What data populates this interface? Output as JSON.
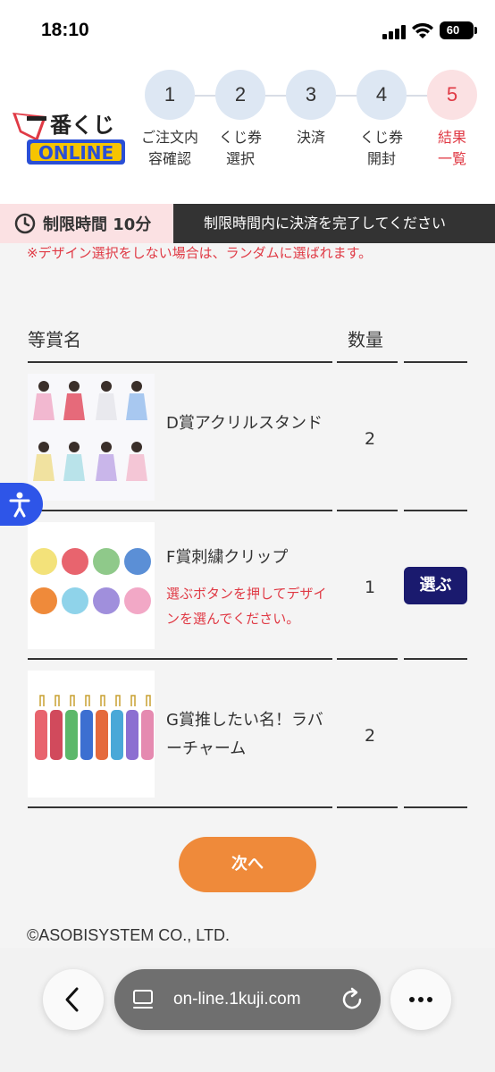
{
  "status_bar": {
    "time": "18:10",
    "battery": "60"
  },
  "header": {
    "logo_text": "一番くじ ONLINE",
    "steps": [
      {
        "number": "1",
        "label": "ご注文内容確認"
      },
      {
        "number": "2",
        "label": "くじ券選択"
      },
      {
        "number": "3",
        "label": "決済"
      },
      {
        "number": "4",
        "label": "くじ券開封"
      },
      {
        "number": "5",
        "label": "結果一覧"
      }
    ],
    "active_step": 5,
    "colors": {
      "active": "#e03a45",
      "inactive_circle": "#dde7f3"
    }
  },
  "time_limit": {
    "label": "制限時間 10分",
    "message": "制限時間内に決済を完了してください"
  },
  "notice": "※デザイン選択をしない場合は、ランダムに選ばれます。",
  "table": {
    "headers": {
      "name": "等賞名",
      "quantity": "数量"
    },
    "rows": [
      {
        "name": "D賞アクリルスタンド",
        "quantity": "2",
        "hint": "",
        "button": ""
      },
      {
        "name": "F賞刺繍クリップ",
        "quantity": "1",
        "hint": "選ぶボタンを押してデザインを選んでください。",
        "button": "選ぶ"
      },
      {
        "name": "G賞推したい名！ラバーチャーム",
        "quantity": "2",
        "hint": "",
        "button": ""
      }
    ]
  },
  "next_button": "次へ",
  "copyright": "©ASOBISYSTEM CO., LTD.",
  "browser": {
    "url": "on-line.1kuji.com"
  },
  "colors": {
    "accent_orange": "#ef8a3a",
    "select_navy": "#1a1a6e",
    "alert_red": "#e03a45"
  }
}
